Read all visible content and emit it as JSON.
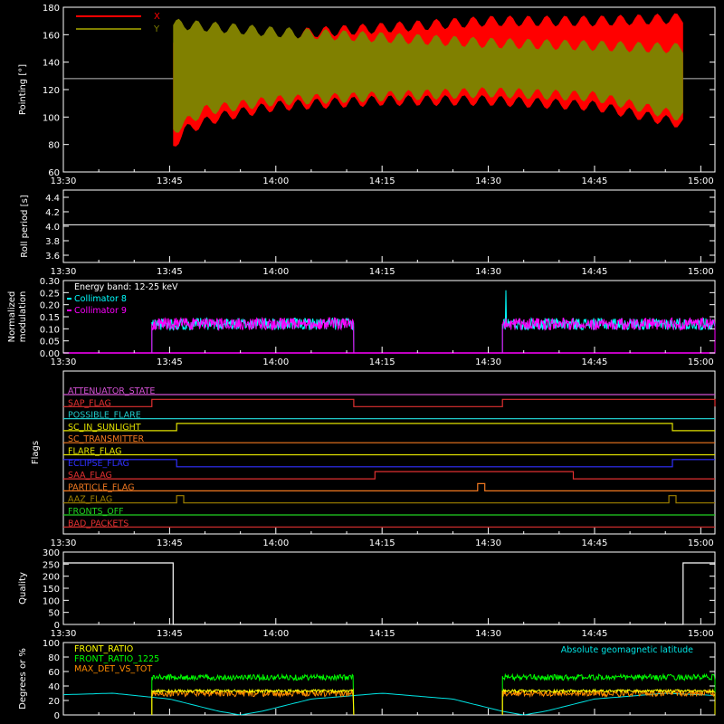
{
  "colors": {
    "background": "#000000",
    "axes": "#ffffff",
    "x_pointing": "#ff0000",
    "y_pointing": "#808000",
    "collimator_8": "#00ffff",
    "collimator_9": "#ff00ff",
    "front_ratio": "#ffff00",
    "front_ratio_1225": "#00ff00",
    "max_det_vs_tot": "#ff8c00",
    "geomag": "#00e5e5"
  },
  "time_axis": {
    "ticks": [
      "13:30",
      "13:45",
      "14:00",
      "14:15",
      "14:30",
      "14:45",
      "15:00"
    ],
    "range_minutes": [
      0,
      92
    ]
  },
  "chart_data": [
    {
      "id": "pointing",
      "type": "area",
      "ylabel": "Pointing [°]",
      "ylim": [
        60,
        180
      ],
      "yticks": [
        "60",
        "80",
        "100",
        "120",
        "140",
        "160",
        "180"
      ],
      "reference_line": 128,
      "legend": [
        "X",
        "Y"
      ],
      "legend_position": "top-left",
      "series": [
        {
          "name": "X",
          "color": "#ff0000",
          "start_min": 15.5,
          "end_min": 87.5,
          "upper": [
            [
              15.5,
              155
            ],
            [
              30,
              160
            ],
            [
              45,
              165
            ],
            [
              60,
              170
            ],
            [
              75,
              170
            ],
            [
              87.5,
              172
            ]
          ],
          "lower": [
            [
              15.5,
              78
            ],
            [
              17,
              90
            ],
            [
              22,
              100
            ],
            [
              30,
              108
            ],
            [
              45,
              112
            ],
            [
              60,
              112
            ],
            [
              75,
              108
            ],
            [
              87.5,
              95
            ]
          ]
        },
        {
          "name": "Y",
          "color": "#808000",
          "start_min": 15.5,
          "end_min": 87.5,
          "upper": [
            [
              15.5,
              168
            ],
            [
              30,
              162
            ],
            [
              45,
              158
            ],
            [
              60,
              154
            ],
            [
              75,
              152
            ],
            [
              87.5,
              150
            ]
          ],
          "lower": [
            [
              15.5,
              90
            ],
            [
              20,
              105
            ],
            [
              30,
              112
            ],
            [
              45,
              115
            ],
            [
              60,
              118
            ],
            [
              75,
              115
            ],
            [
              87.5,
              100
            ]
          ]
        }
      ]
    },
    {
      "id": "roll_period",
      "type": "line",
      "ylabel": "Roll period [s]",
      "ylim": [
        3.5,
        4.5
      ],
      "yticks": [
        "3.6",
        "3.8",
        "4.0",
        "4.2",
        "4.4"
      ],
      "series": [
        {
          "name": "",
          "value": 4.02
        }
      ]
    },
    {
      "id": "modulation",
      "type": "line",
      "ylabel_lines": [
        "Normalized",
        "modulation"
      ],
      "ylim": [
        0,
        0.3
      ],
      "yticks": [
        "0.00",
        "0.05",
        "0.10",
        "0.15",
        "0.20",
        "0.25",
        "0.30"
      ],
      "annotation": "Energy band: 12-25 keV",
      "legend": [
        "Collimator 8",
        "Collimator 9"
      ],
      "intervals_min": [
        [
          12.5,
          41
        ],
        [
          62,
          92
        ]
      ],
      "end_min": 92,
      "typical_value": 0.12,
      "spike_value": 0.26,
      "spike_min": 62.5
    },
    {
      "id": "flags",
      "type": "line",
      "ylabel": "Flags",
      "flags": [
        {
          "name": "ATTENUATOR_STATE",
          "color": "#d050d0",
          "steps": [
            [
              0,
              0
            ]
          ]
        },
        {
          "name": "SAP_FLAG",
          "color": "#e03030",
          "steps": [
            [
              0,
              0
            ],
            [
              12.5,
              1
            ],
            [
              41,
              0
            ],
            [
              62,
              1
            ],
            [
              92,
              0
            ]
          ]
        },
        {
          "name": "POSSIBLE_FLARE",
          "color": "#20c8c8",
          "steps": [
            [
              0,
              0
            ]
          ]
        },
        {
          "name": "SC_IN_SUNLIGHT",
          "color": "#e0e000",
          "steps": [
            [
              0,
              0
            ],
            [
              16,
              1
            ],
            [
              86,
              0
            ]
          ]
        },
        {
          "name": "SC_TRANSMITTER",
          "color": "#f07820",
          "steps": [
            [
              0,
              0
            ]
          ]
        },
        {
          "name": "FLARE_FLAG",
          "color": "#e0e000",
          "steps": [
            [
              0,
              0
            ]
          ]
        },
        {
          "name": "ECLIPSE_FLAG",
          "color": "#3030ff",
          "steps": [
            [
              0,
              1
            ],
            [
              16,
              0
            ],
            [
              86,
              1
            ]
          ]
        },
        {
          "name": "SAA_FLAG",
          "color": "#e03030",
          "steps": [
            [
              0,
              0
            ],
            [
              44,
              1
            ],
            [
              72,
              0
            ]
          ]
        },
        {
          "name": "PARTICLE_FLAG",
          "color": "#f07820",
          "steps": [
            [
              0,
              0
            ],
            [
              58.5,
              1
            ],
            [
              59.5,
              0
            ]
          ]
        },
        {
          "name": "AAZ_FLAG",
          "color": "#a08000",
          "steps": [
            [
              0,
              0
            ],
            [
              16,
              1
            ],
            [
              17,
              0
            ],
            [
              85.5,
              1
            ],
            [
              86.5,
              0
            ]
          ]
        },
        {
          "name": "FRONTS_OFF",
          "color": "#20d020",
          "steps": [
            [
              0,
              0
            ]
          ]
        },
        {
          "name": "BAD_PACKETS",
          "color": "#e03030",
          "steps": [
            [
              0,
              0
            ]
          ]
        }
      ]
    },
    {
      "id": "quality",
      "type": "line",
      "ylabel": "Quality",
      "ylim": [
        0,
        300
      ],
      "yticks": [
        "0",
        "50",
        "100",
        "150",
        "200",
        "250",
        "300"
      ],
      "steps": [
        [
          0,
          255
        ],
        [
          15.5,
          0
        ],
        [
          87.5,
          255
        ]
      ]
    },
    {
      "id": "ratios",
      "type": "line",
      "ylabel": "Degrees or %",
      "ylim": [
        0,
        100
      ],
      "yticks": [
        "0",
        "20",
        "40",
        "60",
        "80",
        "100"
      ],
      "legend": [
        "FRONT_RATIO",
        "FRONT_RATIO_1225",
        "MAX_DET_VS_TOT"
      ],
      "legend_position": "top-left",
      "annotation": "Absolute geomagnetic latitude",
      "geomag_latitude": [
        [
          0,
          28
        ],
        [
          7,
          30
        ],
        [
          15,
          22
        ],
        [
          22,
          5
        ],
        [
          25,
          0
        ],
        [
          28,
          5
        ],
        [
          35,
          22
        ],
        [
          45,
          30
        ],
        [
          55,
          22
        ],
        [
          62,
          5
        ],
        [
          65,
          0
        ],
        [
          68,
          5
        ],
        [
          75,
          22
        ],
        [
          85,
          30
        ],
        [
          92,
          27
        ]
      ],
      "front_ratio": {
        "intervals_min": [
          [
            12.5,
            41
          ],
          [
            62,
            92
          ]
        ],
        "value": 33
      },
      "front_ratio_1225": {
        "intervals_min": [
          [
            12.5,
            41
          ],
          [
            62,
            92
          ]
        ],
        "value": 52
      },
      "max_det_vs_tot": {
        "intervals_min": [
          [
            12.5,
            41
          ],
          [
            62,
            92
          ]
        ],
        "value": 30
      }
    }
  ]
}
